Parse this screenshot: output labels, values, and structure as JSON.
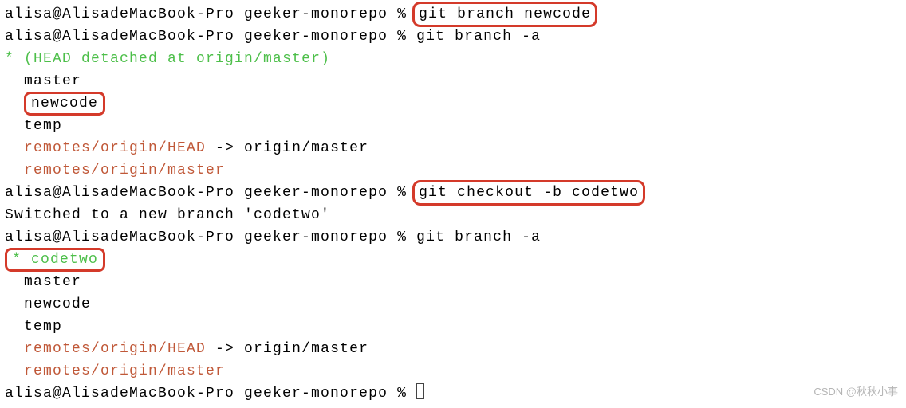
{
  "prompt1": "alisa@AlisadeMacBook-Pro geeker-monorepo % ",
  "prompt2": "alisa@AlisadeMacBook-Pro geeker-monorepo % ",
  "prompt3": "alisa@AlisadeMacBook-Pro geeker-monorepo % ",
  "prompt4": "alisa@AlisadeMacBook-Pro geeker-monorepo % ",
  "prompt5": "alisa@AlisadeMacBook-Pro geeker-monorepo % ",
  "cmd1": "git branch newcode",
  "cmd2": "git branch -a",
  "cmd3": "git checkout -b codetwo",
  "cmd4": "git branch -a",
  "out1": {
    "star": "* ",
    "head": "(HEAD detached at origin/master)",
    "master": "  master",
    "newcode": "newcode",
    "temp": "  temp",
    "r1a": "  remotes/origin/HEAD",
    "r1b": " -> origin/master",
    "r2": "  remotes/origin/master"
  },
  "switched": "Switched to a new branch 'codetwo'",
  "out2": {
    "star": "* ",
    "codetwo": "codetwo",
    "master": "  master",
    "newcode": "  newcode",
    "temp": "  temp",
    "r1a": "  remotes/origin/HEAD",
    "r1b": " -> origin/master",
    "r2": "  remotes/origin/master"
  },
  "watermark": "CSDN @秋秋小事"
}
